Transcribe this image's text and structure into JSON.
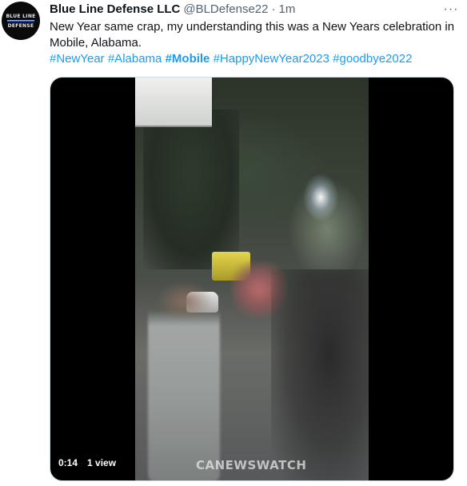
{
  "tweet": {
    "avatar_text": [
      "BLUE LINE",
      "DEFENSE"
    ],
    "author_name": "Blue Line Defense LLC",
    "handle": "@BLDefense22",
    "separator": "·",
    "timestamp": "1m",
    "more_label": "···",
    "text": "New Year same crap, my understanding this was a New Years celebration in Mobile, Alabama.",
    "hashtags": [
      {
        "text": "#NewYear",
        "bold": false
      },
      {
        "text": "#Alabama",
        "bold": false
      },
      {
        "text": "#Mobile",
        "bold": true
      },
      {
        "text": "#HappyNewYear2023",
        "bold": false
      },
      {
        "text": "#goodbye2022",
        "bold": false
      }
    ],
    "video": {
      "duration": "0:14",
      "views": "1 view",
      "watermark": "CANEWSWATCH"
    }
  },
  "colors": {
    "link": "#1d9bf0",
    "text": "#0f1419",
    "muted": "#536471"
  }
}
